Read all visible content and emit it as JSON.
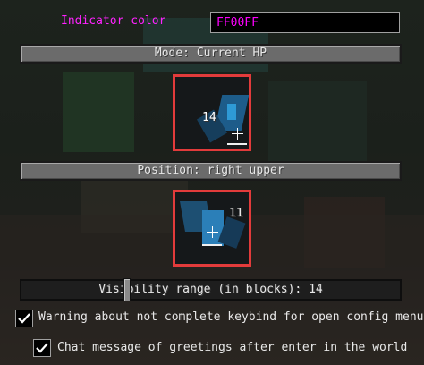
{
  "indicator": {
    "label": "Indicator color",
    "value": "FF00FF",
    "label_color": "#ff22ff",
    "value_color": "#ff00ff"
  },
  "mode_button": {
    "label": "Mode: Current HP"
  },
  "preview_top": {
    "number": "14"
  },
  "position_button": {
    "label": "Position: right upper"
  },
  "preview_bottom": {
    "number": "11"
  },
  "visibility": {
    "label": "Visibility range (in blocks): 14",
    "value": 14
  },
  "checkboxes": [
    {
      "label": "Warning about not complete keybind for open config menu",
      "checked": true
    },
    {
      "label": "Chat message of greetings after enter in the world",
      "checked": true
    }
  ],
  "preview_border_color": "#e23b3b"
}
